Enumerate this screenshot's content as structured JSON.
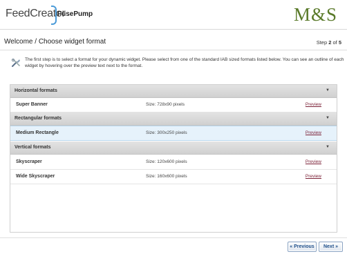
{
  "header": {
    "brand_feed": "FeedCreator",
    "brand_fusepump": "FusePump",
    "client_logo": "M&S"
  },
  "page": {
    "title": "Welcome / Choose widget format",
    "step_prefix": "Step ",
    "step_current": "2",
    "step_of": " of ",
    "step_total": "5"
  },
  "intro": {
    "icon": "tools-icon",
    "text": "The first step is to select a format for your dynamic widget. Please select from one of the standard IAB sized formats listed below. You can see an outline of each widget by hovering over the preview text next to the format."
  },
  "groups": [
    {
      "label": "Horizontal formats",
      "arrow": "▼"
    },
    {
      "label": "Rectangular formats",
      "arrow": "▼"
    },
    {
      "label": "Vertical formats",
      "arrow": "▼"
    }
  ],
  "rows": [
    {
      "name": "Super Banner",
      "size": "Size: 728x90 pixels",
      "preview": "Preview"
    },
    {
      "name": "Medium Rectangle",
      "size": "Size: 300x250 pixels",
      "preview": "Preview",
      "selected": true
    },
    {
      "name": "Skyscraper",
      "size": "Size: 120x600 pixels",
      "preview": "Preview"
    },
    {
      "name": "Wide Skyscraper",
      "size": "Size: 160x600 pixels",
      "preview": "Preview"
    }
  ],
  "nav": {
    "previous_label": "« Previous",
    "next_label": "Next »"
  }
}
